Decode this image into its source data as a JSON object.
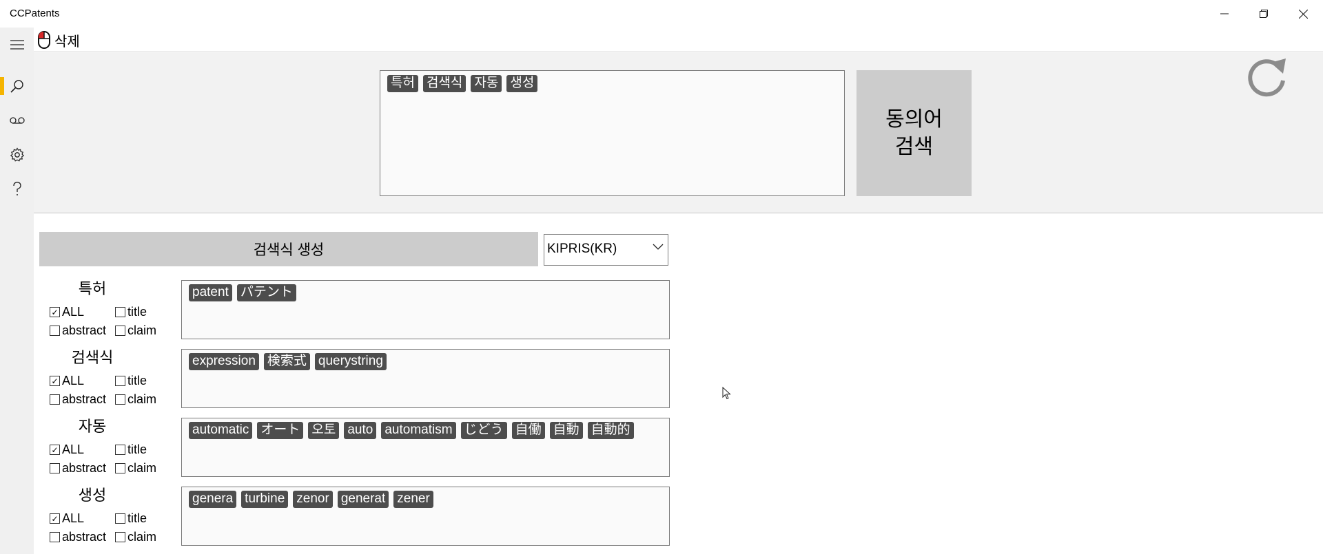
{
  "window": {
    "title": "CCPatents"
  },
  "cmdbar": {
    "delete_label": "삭제"
  },
  "query": {
    "keywords": [
      "특허",
      "검색식",
      "자동",
      "생성"
    ],
    "synonym_button": "동의어\n검색"
  },
  "generate": {
    "button_label": "검색식 생성",
    "db_selected": "KIPRIS(KR)"
  },
  "checkbox_labels": {
    "all": "ALL",
    "title": "title",
    "abstract": "abstract",
    "claim": "claim"
  },
  "terms": [
    {
      "label": "특허",
      "all": true,
      "title": false,
      "abstract": false,
      "claim": false,
      "synonyms": [
        "patent",
        "パテント"
      ]
    },
    {
      "label": "검색식",
      "all": true,
      "title": false,
      "abstract": false,
      "claim": false,
      "synonyms": [
        "expression",
        "検索式",
        "querystring"
      ]
    },
    {
      "label": "자동",
      "all": true,
      "title": false,
      "abstract": false,
      "claim": false,
      "synonyms": [
        "automatic",
        "オート",
        "오토",
        "auto",
        "automatism",
        "じどう",
        "自働",
        "自動",
        "自動的"
      ]
    },
    {
      "label": "생성",
      "all": true,
      "title": false,
      "abstract": false,
      "claim": false,
      "synonyms": [
        "genera",
        "turbine",
        "zenor",
        "generat",
        "zener"
      ]
    }
  ],
  "icons": {
    "nav": [
      "hamburger-icon",
      "search-icon",
      "voicemail-icon",
      "gear-icon",
      "help-icon"
    ],
    "accent": "#f5b400"
  }
}
